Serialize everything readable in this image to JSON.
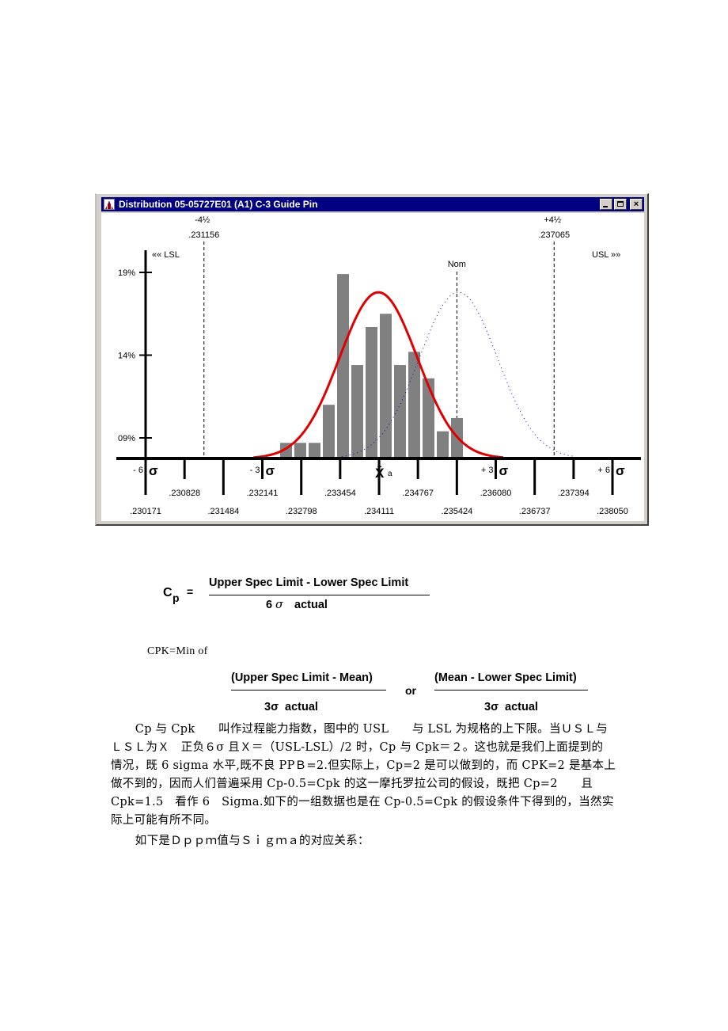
{
  "window": {
    "title": "Distribution 05-05727E01 (A1) C-3 Guide Pin",
    "app_icon": "distribution-chart-icon",
    "buttons": {
      "minimize": "_",
      "maximize": "□",
      "close": "×"
    }
  },
  "chart_data": {
    "type": "bar",
    "title": "Distribution 05-05727E01 (A1) C-3 Guide Pin",
    "xlabel": "",
    "ylabel": "%",
    "y_ticks": [
      "19%",
      "14%",
      "09%"
    ],
    "y_tick_values": [
      19,
      14,
      9
    ],
    "ylim": [
      7.8,
      21
    ],
    "grid": false,
    "bins": 13,
    "values": [
      8.7,
      8.7,
      8.7,
      11.0,
      18.9,
      13.4,
      15.7,
      16.5,
      13.4,
      14.2,
      12.6,
      9.4,
      10.2
    ],
    "x_range": [
      0.230171,
      0.23805
    ],
    "bin_range": [
      0.2327,
      0.235
    ],
    "lsl_label": "«« LSL",
    "usl_label": "USL »»",
    "minus_4_5_sigma": {
      "label": "-4½",
      "value": ".231156",
      "x": 0.231156
    },
    "plus_4_5_sigma": {
      "label": "+4½",
      "value": ".237065",
      "x": 0.237065
    },
    "nominal": {
      "label": "Nom",
      "x": 0.235424
    },
    "mean_label": "X̄",
    "mean_sub": "a",
    "sigma_marks": [
      {
        "prefix": "- 6",
        "symbol": "σ",
        "x": 0.230171
      },
      {
        "prefix": "- 3",
        "symbol": "σ",
        "x": 0.232141
      },
      {
        "prefix": "+ 3",
        "symbol": "σ",
        "x": 0.23608
      },
      {
        "prefix": "+ 6",
        "symbol": "σ",
        "x": 0.23805
      }
    ],
    "x_ticks_lower": [
      ".230171",
      ".231484",
      ".232798",
      ".234111",
      ".235424",
      ".236737",
      ".238050"
    ],
    "x_ticks_upper": [
      ".230828",
      ".232141",
      ".233454",
      ".234767",
      ".236080",
      ".237394"
    ],
    "series": [
      {
        "name": "Histogram",
        "color": "#808080"
      },
      {
        "name": "Actual distribution curve",
        "color": "#e00000",
        "mean": 0.2341,
        "peak_pct": 17.8
      },
      {
        "name": "Nominal-centered curve",
        "color": "#0000c0",
        "style": "dotted",
        "mean": 0.23545,
        "peak_pct": 17.8
      }
    ]
  },
  "formulas": {
    "cp_symbol": "C",
    "cp_sub": "p",
    "equals": "=",
    "cp_numerator": "Upper Spec Limit - Lower Spec Limit",
    "cp_denominator_6": "6",
    "cp_denominator_sigma": "σ",
    "cp_denominator_rest": "actual",
    "cpk_label": "CPK=Min of",
    "cpk_left_numerator": "(Upper Spec Limit - Mean)",
    "cpk_left_denominator": "3σ  actual",
    "cpk_or": "or",
    "cpk_right_numerator": "(Mean - Lower Spec Limit)",
    "cpk_right_denominator": "3σ  actual"
  },
  "paragraph": {
    "lines": [
      "　Cp 与 Cpk　　叫作过程能力指数，图中的 USL　　与 LSL 为规格的上下限。当ＵＳＬ与",
      "ＬＳＬ为Ｘ　正负６σ 且Ｘ＝（USL-LSL）/2 时，Cp 与 Cpk＝２。这也就是我们上面提到的",
      "情况，既 6 sigma 水平,既不良 PPＢ=2.但实际上，Cp=2 是可以做到的，而 CPK=2 是基本上",
      "做不到的，因而人们普遍采用 Cp-0.5=Cpk 的这一摩托罗拉公司的假设，既把 Cp=2　　且",
      "Cpk=1.5　看作 6　Sigma.如下的一组数据也是在 Cp-0.5=Cpk 的假设条件下得到的，当然实",
      "际上可能有所不同。",
      "　如下是Ｄｐｐｍ值与Ｓｉｇｍａ的对应关系："
    ]
  }
}
